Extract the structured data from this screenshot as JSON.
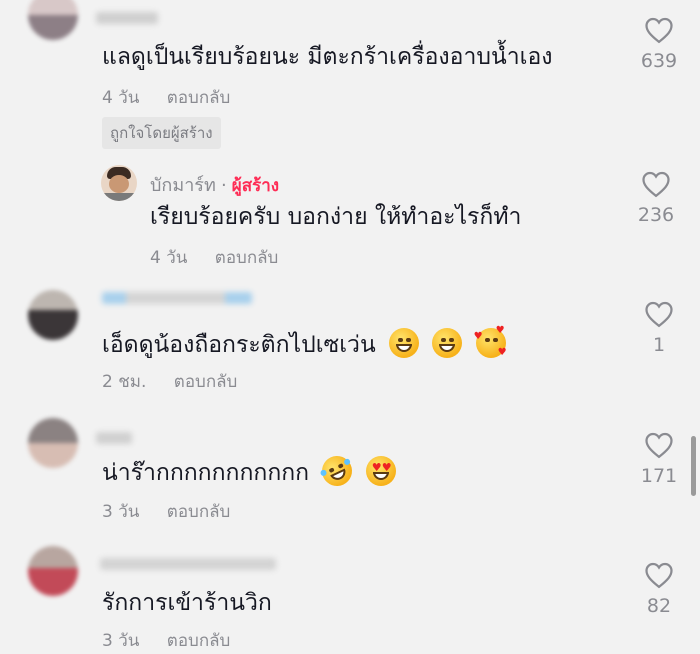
{
  "comments": [
    {
      "text": "แลดูเป็นเรียบร้อยนะ มีตะกร้าเครื่องอาบน้ำเอง",
      "time": "4 วัน",
      "reply_label": "ตอบกลับ",
      "badge": "ถูกใจโดยผู้สร้าง",
      "likes": "639"
    },
    {
      "author": "บักมาร์ท",
      "separator": "·",
      "role": "ผู้สร้าง",
      "text": "เรียบร้อยครับ บอกง่าย ให้ทำอะไรก็ทำ",
      "time": "4 วัน",
      "reply_label": "ตอบกลับ",
      "likes": "236"
    },
    {
      "text": "เอ็ดดูน้องถือกระติกไปเซเว่น",
      "emojis": [
        "grinning-face-emoji",
        "grinning-face-emoji",
        "smiling-face-with-hearts-emoji"
      ],
      "time": "2 ชม.",
      "reply_label": "ตอบกลับ",
      "likes": "1"
    },
    {
      "text": "น่าร๊ากกกกกกกกกกก",
      "emojis": [
        "rolling-on-floor-laughing-emoji",
        "heart-eyes-emoji"
      ],
      "time": "3 วัน",
      "reply_label": "ตอบกลับ",
      "likes": "171"
    },
    {
      "text": "รักการเข้าร้านวิก",
      "time": "3 วัน",
      "reply_label": "ตอบกลับ",
      "likes": "82"
    }
  ],
  "colors": {
    "background": "#f2f2f2",
    "text": "#161823",
    "muted": "#8a8b91",
    "creator_accent": "#fe2c55"
  }
}
